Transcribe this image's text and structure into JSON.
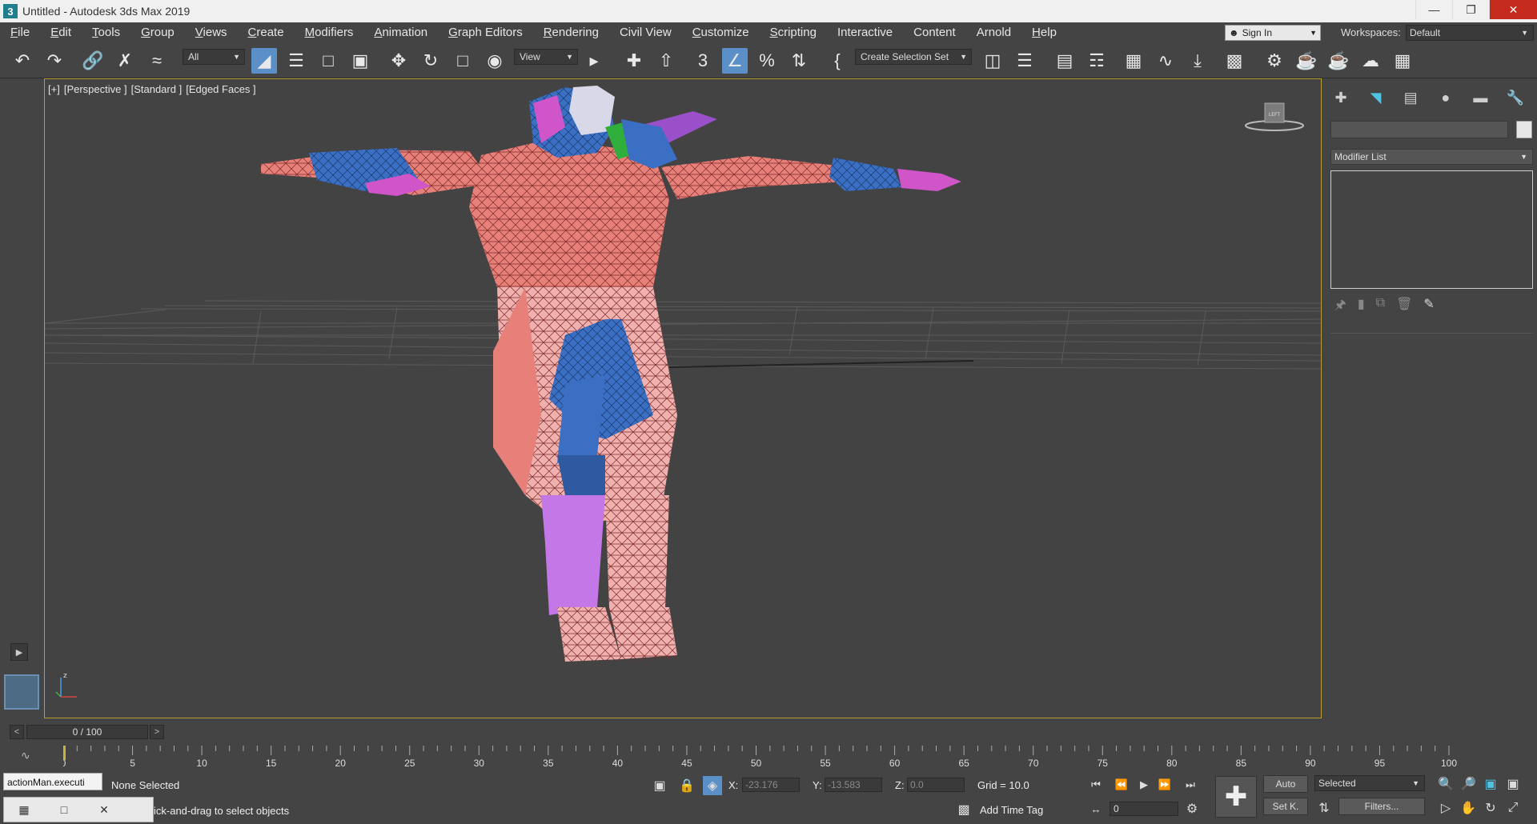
{
  "window": {
    "title": "Untitled - Autodesk 3ds Max 2019",
    "app_icon": "3",
    "buttons": [
      "—",
      "❐",
      "✕"
    ]
  },
  "menu": [
    {
      "label": "File",
      "u": "F",
      "rest": "ile"
    },
    {
      "label": "Edit",
      "u": "E",
      "rest": "dit"
    },
    {
      "label": "Tools",
      "u": "T",
      "rest": "ools"
    },
    {
      "label": "Group",
      "u": "G",
      "rest": "roup"
    },
    {
      "label": "Views",
      "u": "V",
      "rest": "iews"
    },
    {
      "label": "Create",
      "u": "C",
      "rest": "reate"
    },
    {
      "label": "Modifiers",
      "u": "M",
      "rest": "odifiers"
    },
    {
      "label": "Animation",
      "u": "A",
      "rest": "nimation"
    },
    {
      "label": "Graph Editors",
      "u": "G",
      "rest": "raph Editors"
    },
    {
      "label": "Rendering",
      "u": "R",
      "rest": "endering"
    },
    {
      "label": "Civil View",
      "u": "",
      "rest": "Civil View"
    },
    {
      "label": "Customize",
      "u": "C",
      "rest": "ustomize"
    },
    {
      "label": "Scripting",
      "u": "S",
      "rest": "cripting"
    },
    {
      "label": "Interactive",
      "u": "",
      "rest": "Interactive"
    },
    {
      "label": "Content",
      "u": "",
      "rest": "Content"
    },
    {
      "label": "Arnold",
      "u": "",
      "rest": "Arnold"
    },
    {
      "label": "Help",
      "u": "H",
      "rest": "elp"
    }
  ],
  "signin": {
    "label": "Sign In",
    "icon": "user-icon"
  },
  "workspaces": {
    "label": "Workspaces:",
    "value": "Default"
  },
  "toolbar": {
    "filter_value": "All",
    "refcoord_value": "View",
    "selection_set_placeholder": "Create Selection Set"
  },
  "viewport": {
    "label_parts": [
      "[+]",
      "[Perspective ]",
      "[Standard ]",
      "[Edged Faces ]"
    ],
    "viewcube_label": "LEFT",
    "axis_z": "z"
  },
  "command_panel": {
    "modifier_list": "Modifier List",
    "tabs": [
      "create-icon",
      "modify-icon",
      "hierarchy-icon",
      "motion-icon",
      "display-icon",
      "utilities-icon"
    ]
  },
  "time_slider": {
    "value": "0 / 100",
    "prev": "<",
    "next": ">"
  },
  "track_bar": {
    "ticks": [
      0,
      5,
      10,
      15,
      20,
      25,
      30,
      35,
      40,
      45,
      50,
      55,
      60,
      65,
      70,
      75,
      80,
      85,
      90,
      95,
      100
    ]
  },
  "status": {
    "maxscript_text": "actionMan.executi",
    "selection": "None Selected",
    "prompt": "ick-and-drag to select objects",
    "x_label": "X:",
    "x_value": "-23.176",
    "y_label": "Y:",
    "y_value": "-13.583",
    "z_label": "Z:",
    "z_value": "0.0",
    "grid": "Grid = 10.0",
    "add_time_tag": "Add Time Tag",
    "frame_value": "0",
    "auto_key": "Auto",
    "set_key": "Set K.",
    "key_filter_value": "Selected",
    "filters": "Filters..."
  }
}
